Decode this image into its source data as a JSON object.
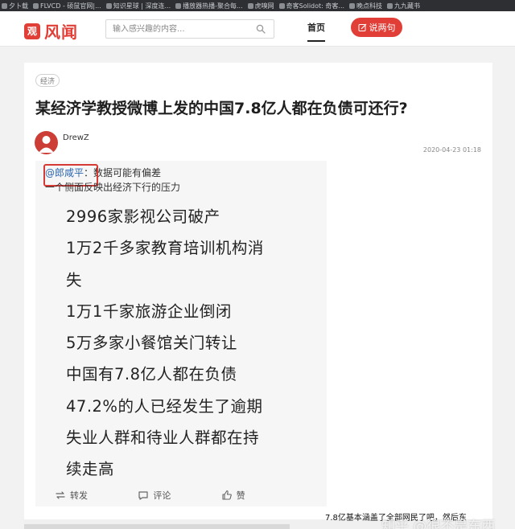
{
  "bookmarks": [
    {
      "label": "夕卜载"
    },
    {
      "label": "FLVCD - 硕鼠官网|..."
    },
    {
      "label": "知识星球 | 深度连..."
    },
    {
      "label": "播放器热播-聚合每..."
    },
    {
      "label": "虎嗅网"
    },
    {
      "label": "奇客Solidot: 奇客..."
    },
    {
      "label": "晚点科技"
    },
    {
      "label": "九九藏书"
    }
  ],
  "header": {
    "logo_mark": "观",
    "logo_text": "风闻",
    "search_placeholder": "输入感兴趣的内容...",
    "nav_home": "首页",
    "say_button": "说两句"
  },
  "article": {
    "tag": "经济",
    "title": "某经济学教授微博上发的中国7.8亿人都在负债可还行?",
    "author": "DrewZ",
    "date": "2020-04-23 01:18"
  },
  "weibo": {
    "mention": "@郎咸平",
    "mention_text": "：数据可能有偏差",
    "sub_line": "一个侧面反映出经济下行的压力",
    "lines": [
      "2996家影视公司破产",
      "1万2千多家教育培训机构消",
      "失",
      "1万1千家旅游企业倒闭",
      "5万多家小餐馆关门转让",
      "中国有7.8亿人都在负债",
      "47.2%的人已经发生了逾期",
      "失业人群和待业人群都在持",
      "续走高"
    ],
    "actions": {
      "repost": "转发",
      "comment": "评论",
      "like": "赞"
    }
  },
  "overlay_text": "7.8亿基本涵盖了全部网民了吧，然后东",
  "watermark": "知乎 @很不是东西",
  "colors": {
    "brand_red": "#e03e36",
    "mention_blue": "#2b66b1",
    "highlight_red": "#d73a34"
  }
}
